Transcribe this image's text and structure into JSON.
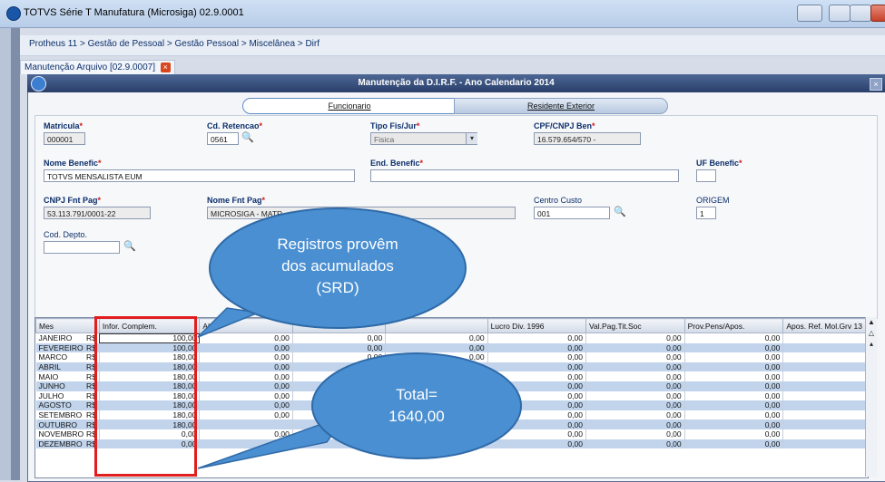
{
  "window": {
    "title": "TOTVS Série T Manufatura (Microsiga) 02.9.0001"
  },
  "breadcrumb": "Protheus 11 > Gestão de Pessoal > Gestão Pessoal > Miscelânea > Dirf",
  "doc_tab": {
    "label": "Manutenção Arquivo [02.9.0007]",
    "close": "×"
  },
  "dialog": {
    "title": "Manutenção da D.I.R.F. - Ano Calendario 2014",
    "close": "×"
  },
  "folder_tabs": {
    "funcionario": "Funcionario",
    "residente": "Residente Exterior"
  },
  "form": {
    "matricula": {
      "label": "Matricula",
      "value": "000001"
    },
    "cd_retencao": {
      "label": "Cd. Retencao",
      "value": "0561"
    },
    "tipo_fis_jur": {
      "label": "Tipo Fis/Jur",
      "value": "Fisica"
    },
    "cpf_cnpj_ben": {
      "label": "CPF/CNPJ Ben",
      "value": "16.579.654/570 -"
    },
    "nome_benefic": {
      "label": "Nome Benefic",
      "value": "TOTVS MENSALISTA EUM"
    },
    "end_benefic": {
      "label": "End. Benefic",
      "value": ""
    },
    "uf_benefic": {
      "label": "UF Benefic",
      "value": ""
    },
    "cnpj_fnt_pag": {
      "label": "CNPJ Fnt Pag",
      "value": "53.113.791/0001-22"
    },
    "nome_fnt_pag": {
      "label": "Nome Fnt Pag",
      "value": "MICROSIGA - MATR"
    },
    "centro_custo": {
      "label": "Centro Custo",
      "value": "001"
    },
    "origem": {
      "label": "ORIGEM",
      "value": "1"
    },
    "cod_depto": {
      "label": "Cod. Depto.",
      "value": ""
    },
    "required_mark": "*"
  },
  "grid": {
    "headers": [
      "Mes",
      "Infor. Complem.",
      "Al",
      "",
      "",
      "Lucro Div. 1996",
      "Val.Pag.Tit.Soc",
      "Prov.Pens/Apos.",
      "Apos. Ref. Mol.Grv 13"
    ],
    "rows": [
      {
        "mes": "JANEIRO",
        "cur": "R$",
        "c1": "100,00",
        "c2": "0,00",
        "c3": "0,00",
        "c4": "0,00",
        "c5": "0,00",
        "c6": "0,00",
        "c7": "0,00"
      },
      {
        "mes": "FEVEREIRO",
        "cur": "R$",
        "c1": "100,00",
        "c2": "0,00",
        "c3": "0,00",
        "c4": "0,00",
        "c5": "0,00",
        "c6": "0,00",
        "c7": "0,00"
      },
      {
        "mes": "MARCO",
        "cur": "R$",
        "c1": "180,00",
        "c2": "0,00",
        "c3": "0,00",
        "c4": "0,00",
        "c5": "0,00",
        "c6": "0,00",
        "c7": "0,00"
      },
      {
        "mes": "ABRIL",
        "cur": "R$",
        "c1": "180,00",
        "c2": "0,00",
        "c3": "",
        "c4": "0,00",
        "c5": "0,00",
        "c6": "0,00",
        "c7": "0,00"
      },
      {
        "mes": "MAIO",
        "cur": "R$",
        "c1": "180,00",
        "c2": "0,00",
        "c3": "",
        "c4": "0,00",
        "c5": "0,00",
        "c6": "0,00",
        "c7": "0,00"
      },
      {
        "mes": "JUNHO",
        "cur": "R$",
        "c1": "180,00",
        "c2": "0,00",
        "c3": "",
        "c4": "0,00",
        "c5": "0,00",
        "c6": "0,00",
        "c7": "0,00"
      },
      {
        "mes": "JULHO",
        "cur": "R$",
        "c1": "180,00",
        "c2": "0,00",
        "c3": "",
        "c4": "0,00",
        "c5": "0,00",
        "c6": "0,00",
        "c7": "0,00"
      },
      {
        "mes": "AGOSTO",
        "cur": "R$",
        "c1": "180,00",
        "c2": "0,00",
        "c3": "",
        "c4": "0,00",
        "c5": "0,00",
        "c6": "0,00",
        "c7": "0,00"
      },
      {
        "mes": "SETEMBRO",
        "cur": "R$",
        "c1": "180,00",
        "c2": "0,00",
        "c3": "",
        "c4": "0,00",
        "c5": "0,00",
        "c6": "0,00",
        "c7": "0,00"
      },
      {
        "mes": "OUTUBRO",
        "cur": "R$",
        "c1": "180,00",
        "c2": "",
        "c3": "",
        "c4": "0,00",
        "c5": "0,00",
        "c6": "0,00",
        "c7": "0,00"
      },
      {
        "mes": "NOVEMBRO",
        "cur": "R$",
        "c1": "0,00",
        "c2": "0,00",
        "c3": "",
        "c4": "0,00",
        "c5": "0,00",
        "c6": "0,00",
        "c7": "0,00"
      },
      {
        "mes": "DEZEMBRO",
        "cur": "R$",
        "c1": "0,00",
        "c2": "0,00",
        "c3": "0,00",
        "c4": "0,00",
        "c5": "0,00",
        "c6": "0,00",
        "c7": "0,00"
      }
    ]
  },
  "callouts": {
    "top": [
      "Registros provêm",
      "dos acumulados",
      "(SRD)"
    ],
    "bottom": [
      "Total=",
      "1640,00"
    ]
  },
  "colors": {
    "callout_fill": "#4a8fd1",
    "callout_stroke": "#2f6aa8",
    "highlight": "#e21d1d",
    "row_alt": "#c1d4ec",
    "dialog_header": "#2a3f6a"
  },
  "icons": {
    "lookup": "magnifier-icon",
    "app": "totvs-logo-icon",
    "scroll": "scroll-arrow-icon"
  }
}
